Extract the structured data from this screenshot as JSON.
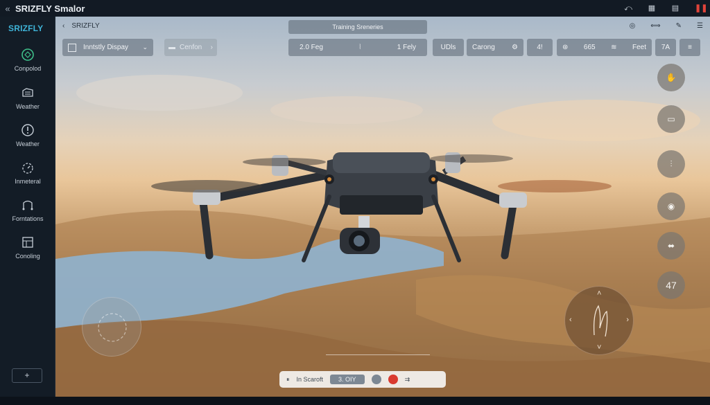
{
  "window": {
    "title": "SRIZFLY Smalor",
    "back_glyph": "«"
  },
  "sidebar": {
    "brand": "SRIZFLY",
    "items": [
      {
        "label": "Conpolod",
        "icon": "compass-icon"
      },
      {
        "label": "Weather",
        "icon": "weather-icon"
      },
      {
        "label": "Weather",
        "icon": "alert-icon"
      },
      {
        "label": "Inmeteral",
        "icon": "timer-icon"
      },
      {
        "label": "Forntations",
        "icon": "formation-icon"
      },
      {
        "label": "Conoling",
        "icon": "panel-icon"
      }
    ],
    "add_label": "+"
  },
  "scene": {
    "breadcrumb": "SRIZFLY",
    "scenario_title": "Training Sreneries",
    "display_select": "Inntstly Dispay",
    "centon_label": "Cenfon",
    "flight": {
      "left": "2.0 Feg",
      "right": "1 Fely"
    },
    "udls": "UDls",
    "carong": "Carong",
    "four": "4!",
    "group_value": "665",
    "feet": "Feet",
    "seven": "7A",
    "right_buttons": [
      "hand-icon",
      "battery-icon",
      "wind-icon",
      "eye-icon",
      "gimbal-icon"
    ],
    "right_number": "47"
  },
  "controls": {
    "mode": "In Scaroft",
    "altitude": "3. OIY"
  },
  "colors": {
    "brand": "#3fb4d8",
    "record": "#d93a2f",
    "sidebar_bg": "#131c26"
  }
}
